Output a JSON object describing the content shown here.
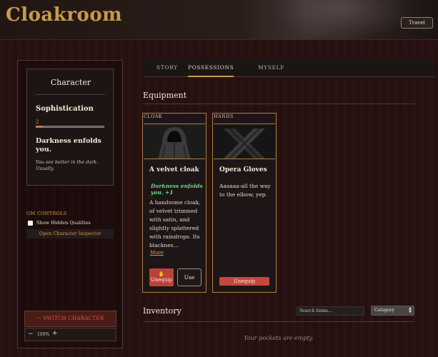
{
  "header": {
    "title": "Cloakroom",
    "travel_label": "Travel"
  },
  "sidebar": {
    "character": {
      "heading": "Character",
      "quality_name": "Sophistication",
      "quality_value": "2",
      "quality_progress_fraction": 0.1,
      "state_name": "Darkness enfolds you.",
      "state_description": "You see better in the dark. Usually."
    },
    "gm_controls": {
      "heading": "GM CONTROLS",
      "show_hidden_label": "Show Hidden Qualities",
      "show_hidden_checked": false,
      "inspector_label": "Open Character Inspector"
    },
    "switch_label": "← SWITCH CHARACTER",
    "zoom": {
      "minus": "−",
      "value": "100%",
      "plus": "+"
    }
  },
  "tabs": [
    {
      "label": "STORY",
      "active": false
    },
    {
      "label": "POSSESSIONS",
      "active": true
    },
    {
      "label": "MYSELF",
      "active": false
    }
  ],
  "equipment": {
    "heading": "Equipment",
    "items": [
      {
        "slot": "CLOAK",
        "name": "A velvet cloak",
        "effect": "Darkness enfolds you. +1",
        "description": "A handsome cloak, of velvet trimmed with satin, and slightly splattered with raindrops. Its blacknes...",
        "more_label": "More",
        "unequip_icon": "hand-icon",
        "unequip_label": "Unequip",
        "use_label": "Use"
      },
      {
        "slot": "HANDS",
        "name": "Opera Gloves",
        "description": "Aaaaaa-all the way to the elbow, yep.",
        "unequip_label": "Unequip"
      }
    ]
  },
  "inventory": {
    "heading": "Inventory",
    "search_placeholder": "Search items...",
    "category_value": "Category",
    "empty_message": "Your pockets are empty."
  },
  "colors": {
    "accent_gold": "#c89a4b",
    "danger_red": "#c7473a",
    "effect_green": "#6bdc8b",
    "gm_orange": "#e39a45"
  }
}
